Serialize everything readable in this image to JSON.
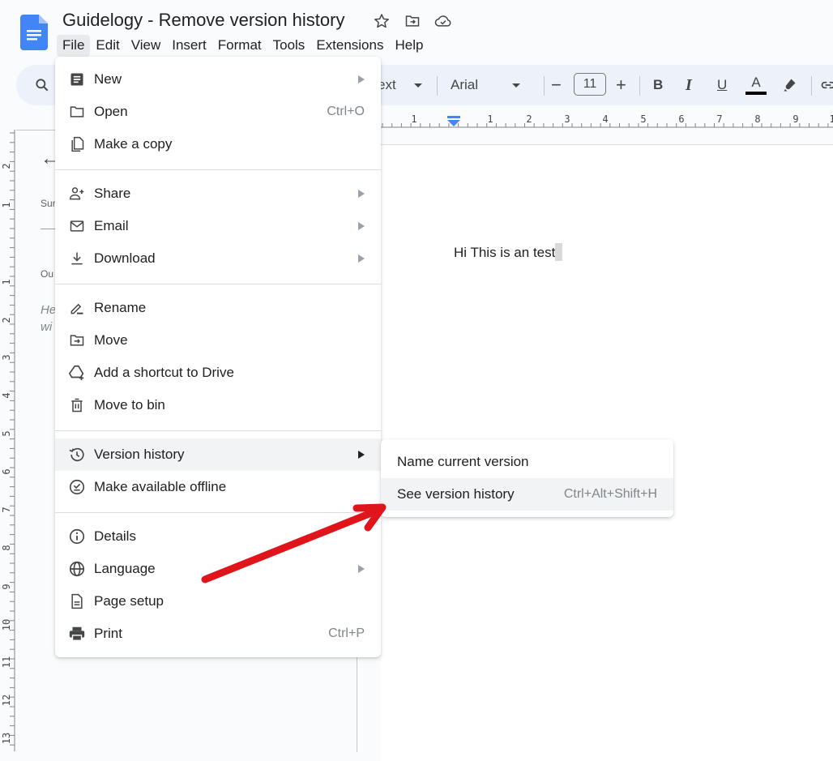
{
  "document": {
    "title": "Guidelogy - Remove version history",
    "body_text": "Hi This is an test"
  },
  "title_icons": [
    "star-icon",
    "move-to-folder-icon",
    "cloud-saved-icon"
  ],
  "menubar": [
    {
      "label": "File",
      "active": true
    },
    {
      "label": "Edit"
    },
    {
      "label": "View"
    },
    {
      "label": "Insert"
    },
    {
      "label": "Format"
    },
    {
      "label": "Tools"
    },
    {
      "label": "Extensions"
    },
    {
      "label": "Help"
    }
  ],
  "toolbar": {
    "style_label": "ext",
    "font": "Arial",
    "font_size": "11",
    "minus": "−",
    "plus": "+",
    "bold": "B",
    "italic": "I",
    "underline": "U",
    "text_color": "A"
  },
  "ruler": {
    "horizontal": [
      "1",
      "1",
      "2",
      "3",
      "4",
      "5",
      "6",
      "7",
      "8",
      "9",
      "1"
    ],
    "vertical": [
      "2",
      "1",
      "1",
      "2",
      "3",
      "4",
      "5",
      "6",
      "7",
      "8",
      "9",
      "10",
      "11",
      "12",
      "13"
    ]
  },
  "side_panel": {
    "summary_label": "Sur",
    "outline_label": "Ou",
    "hint_line1": "He",
    "hint_line2": "wi"
  },
  "file_menu": {
    "items": [
      {
        "label": "New",
        "icon": "new-doc-icon",
        "submenu": true
      },
      {
        "label": "Open",
        "icon": "folder-icon",
        "shortcut": "Ctrl+O"
      },
      {
        "label": "Make a copy",
        "icon": "copy-icon"
      },
      {
        "label": "Share",
        "icon": "share-person-icon",
        "submenu": true
      },
      {
        "label": "Email",
        "icon": "email-icon",
        "submenu": true
      },
      {
        "label": "Download",
        "icon": "download-icon",
        "submenu": true
      },
      {
        "label": "Rename",
        "icon": "rename-icon"
      },
      {
        "label": "Move",
        "icon": "move-folder-icon"
      },
      {
        "label": "Add a shortcut to Drive",
        "icon": "drive-shortcut-icon"
      },
      {
        "label": "Move to bin",
        "icon": "trash-icon"
      },
      {
        "label": "Version history",
        "icon": "history-icon",
        "submenu": true,
        "highlighted": true
      },
      {
        "label": "Make available offline",
        "icon": "offline-icon"
      },
      {
        "label": "Details",
        "icon": "info-icon"
      },
      {
        "label": "Language",
        "icon": "globe-icon",
        "submenu": true
      },
      {
        "label": "Page setup",
        "icon": "page-setup-icon"
      },
      {
        "label": "Print",
        "icon": "print-icon",
        "shortcut": "Ctrl+P"
      }
    ]
  },
  "version_submenu": {
    "items": [
      {
        "label": "Name current version"
      },
      {
        "label": "See version history",
        "shortcut": "Ctrl+Alt+Shift+H",
        "highlighted": true
      }
    ]
  },
  "colors": {
    "accent_blue": "#4285f4",
    "annotation_red": "#e0141b",
    "menu_highlight": "#f1f3f4"
  }
}
